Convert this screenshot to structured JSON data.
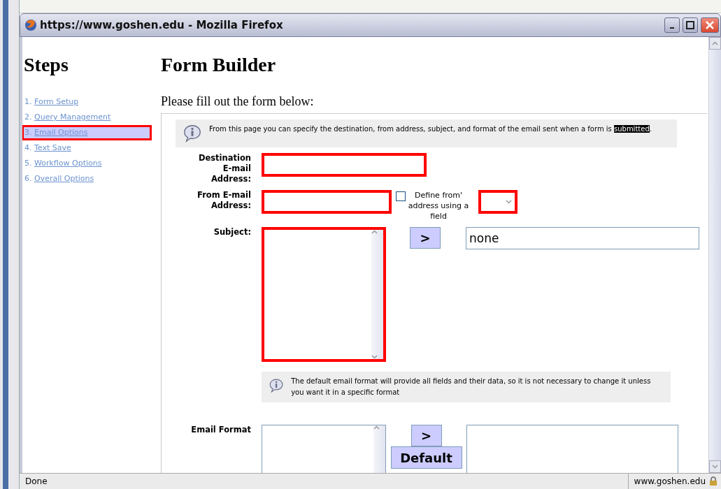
{
  "window": {
    "title": "https://www.goshen.edu - Mozilla Firefox"
  },
  "sidebar": {
    "heading": "Steps",
    "items": [
      {
        "number": "1.",
        "label": "Form Setup",
        "selected": false
      },
      {
        "number": "2.",
        "label": "Query Management",
        "selected": false
      },
      {
        "number": "3.",
        "label": "Email Options",
        "selected": true
      },
      {
        "number": "4.",
        "label": "Text Save",
        "selected": false
      },
      {
        "number": "5.",
        "label": "Workflow Options",
        "selected": false
      },
      {
        "number": "6.",
        "label": "Overall Options",
        "selected": false
      }
    ]
  },
  "page": {
    "title": "Form Builder",
    "intro": "Please fill out the form below:"
  },
  "info_top": {
    "text": "From this page you can specify the destination, from address, subject, and format of the email sent when a form is ",
    "selected_text": "submitted",
    "text_end": "."
  },
  "destination": {
    "label": "Destination E-mail Address:",
    "highlighted": true
  },
  "from": {
    "label": "From E-mail Address:",
    "highlighted": true,
    "checkbox": {
      "label": "Define from' address using a field",
      "checked": false
    },
    "select_highlighted": true
  },
  "subject": {
    "label": "Subject:",
    "highlighted": true,
    "insert_button": ">",
    "value": "none"
  },
  "info_format": {
    "text": "The default email format will provide all fields and their data, so it is not necessary to change it unless you want it in a specific format"
  },
  "email_format": {
    "label": "Email Format",
    "insert_button": ">",
    "default_button": "Default"
  },
  "status_bar": {
    "text": "Done",
    "domain": "www.goshen.edu"
  }
}
